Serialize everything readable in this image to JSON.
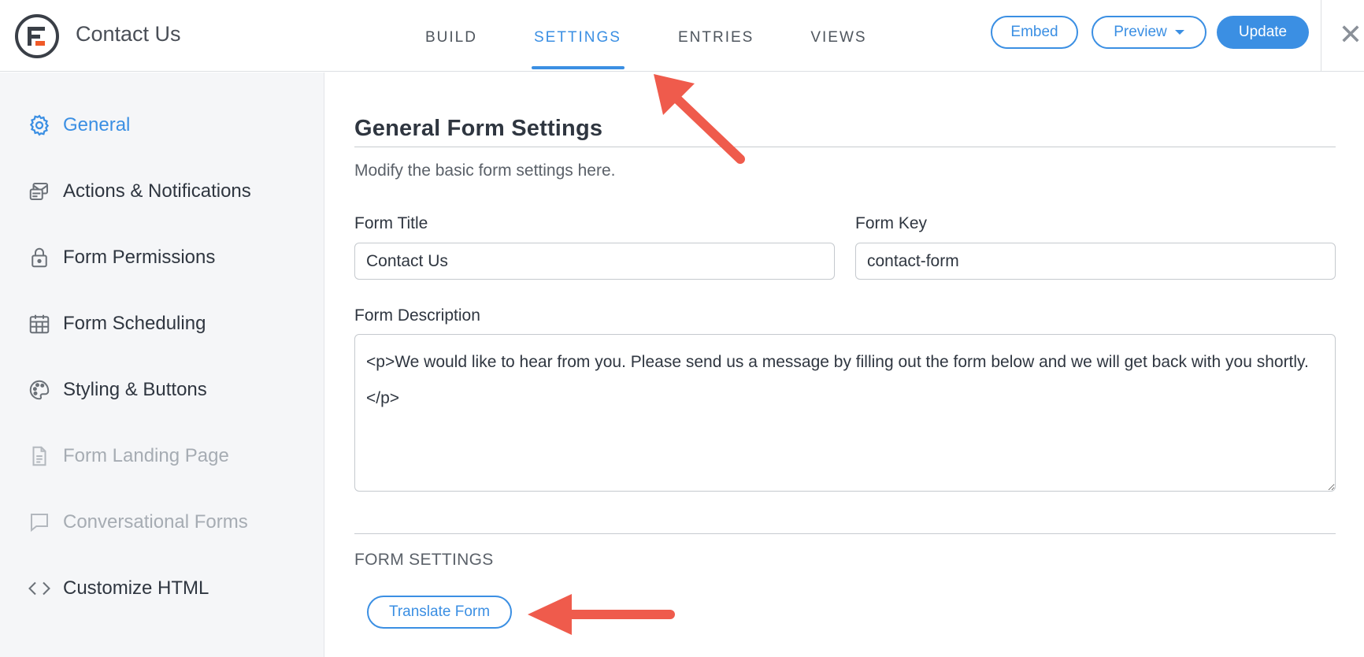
{
  "header": {
    "app_title": "Contact Us",
    "tabs": [
      {
        "label": "BUILD",
        "active": false
      },
      {
        "label": "SETTINGS",
        "active": true
      },
      {
        "label": "ENTRIES",
        "active": false
      },
      {
        "label": "VIEWS",
        "active": false
      }
    ],
    "embed_label": "Embed",
    "preview_label": "Preview",
    "update_label": "Update",
    "close_icon": "close-icon"
  },
  "sidebar": {
    "items": [
      {
        "label": "General",
        "icon": "gear-icon",
        "state": "active"
      },
      {
        "label": "Actions & Notifications",
        "icon": "notifications-icon",
        "state": "normal"
      },
      {
        "label": "Form Permissions",
        "icon": "lock-icon",
        "state": "normal"
      },
      {
        "label": "Form Scheduling",
        "icon": "calendar-icon",
        "state": "normal"
      },
      {
        "label": "Styling & Buttons",
        "icon": "palette-icon",
        "state": "normal"
      },
      {
        "label": "Form Landing Page",
        "icon": "document-icon",
        "state": "disabled"
      },
      {
        "label": "Conversational Forms",
        "icon": "chat-bubble-icon",
        "state": "disabled"
      },
      {
        "label": "Customize HTML",
        "icon": "code-icon",
        "state": "normal"
      }
    ]
  },
  "main": {
    "title": "General Form Settings",
    "description": "Modify the basic form settings here.",
    "form_title_label": "Form Title",
    "form_title_value": "Contact Us",
    "form_key_label": "Form Key",
    "form_key_value": "contact-form",
    "form_description_label": "Form Description",
    "form_description_value": "<p>We would like to hear from you. Please send us a message by filling out the form below and we will get back with you shortly.</p>",
    "section_title": "FORM SETTINGS",
    "translate_label": "Translate Form"
  },
  "colors": {
    "accent": "#3b8fe3",
    "annotation_arrow": "#ef5b4c",
    "sidebar_bg": "#f5f6f8"
  }
}
